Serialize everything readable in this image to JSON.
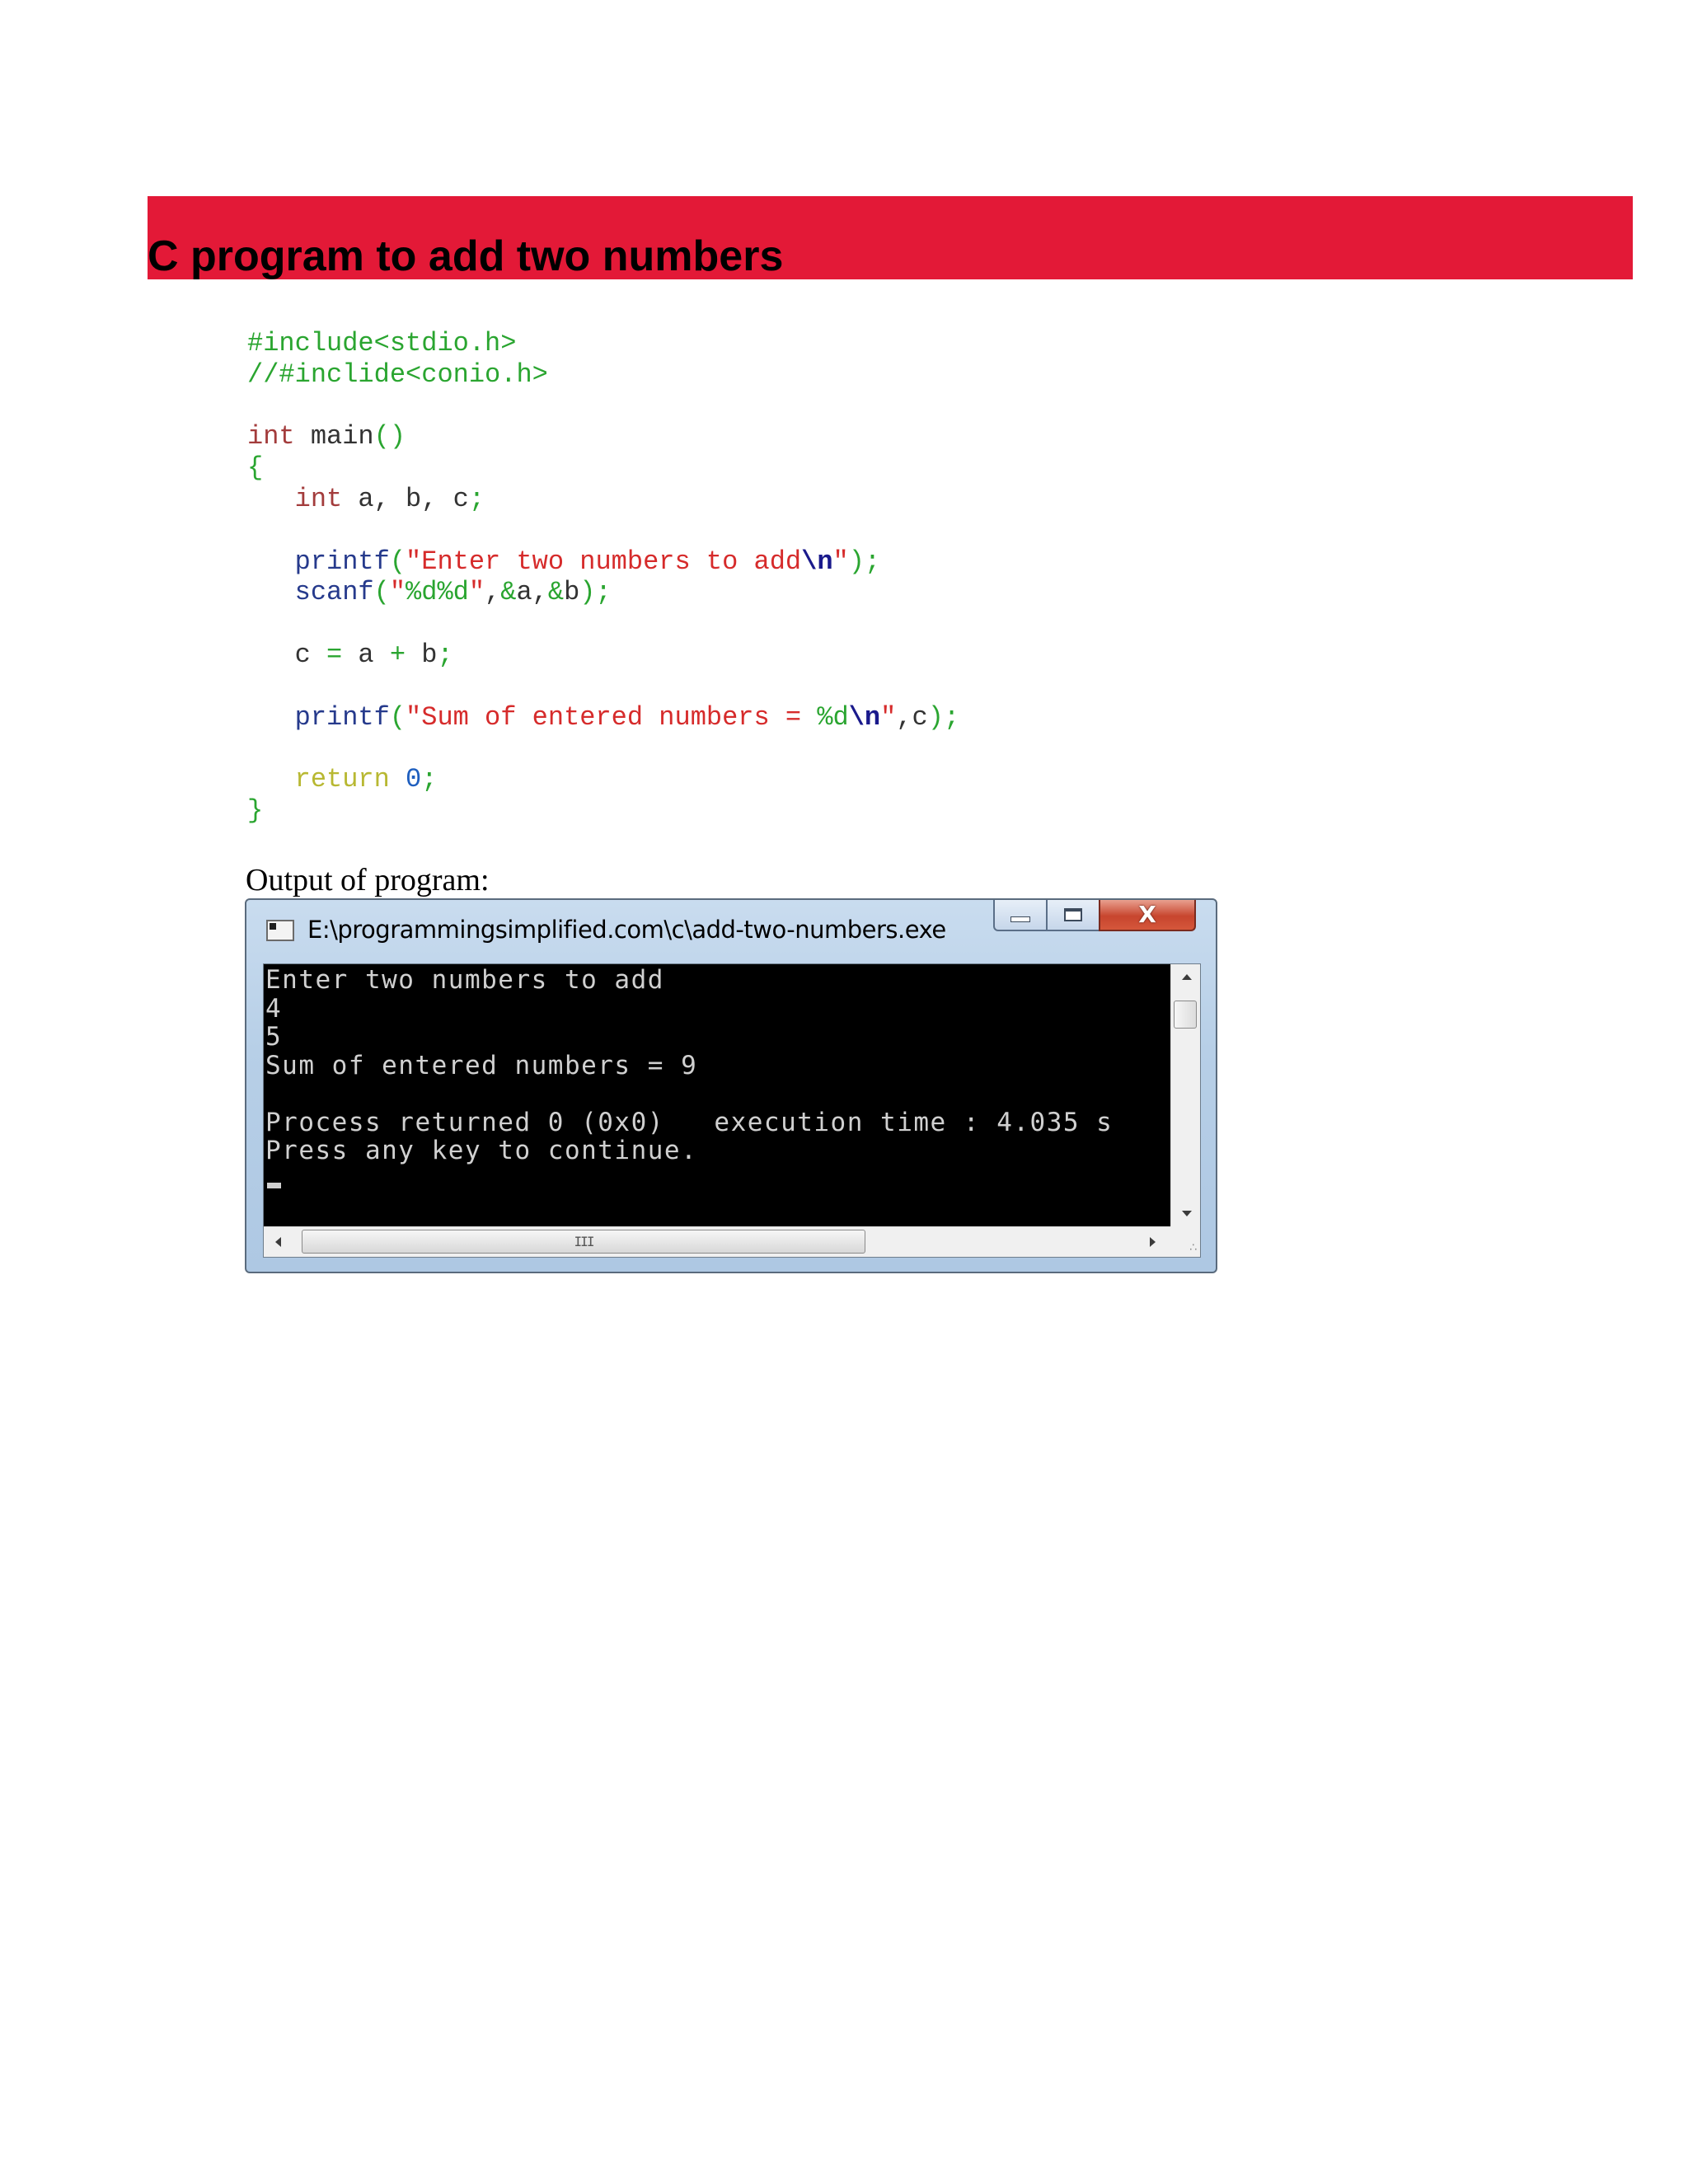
{
  "document": {
    "title": "C program to add two numbers",
    "output_heading": "Output of program:"
  },
  "code": {
    "l1_pre": "#include<stdio.h>",
    "l2_cmt": "//#inclide<conio.h>",
    "l4_type": "int",
    "l4_name": " main",
    "l4_parens": "()",
    "l5_open": "{",
    "l6_indent": "   ",
    "l6_type": "int",
    "l6_vars": " a, b, c",
    "l6_semi": ";",
    "l8_indent": "   ",
    "l8_fn": "printf",
    "l8_paren": "(",
    "l8_str": "\"Enter two numbers to add",
    "l8_esc": "\\n",
    "l8_strend": "\"",
    "l8_close": ");",
    "l9_indent": "   ",
    "l9_fn": "scanf",
    "l9_paren": "(",
    "l9_fmt_q": "\"",
    "l9_fmt": "%d%d",
    "l9_fmt_end": "\"",
    "l9_comma1": ",",
    "l9_amp1": "&",
    "l9_a": "a",
    "l9_comma2": ",",
    "l9_amp2": "&",
    "l9_b": "b",
    "l9_close": ");",
    "l11_indent": "   ",
    "l11_c": "c",
    "l11_eq": " = ",
    "l11_a": "a",
    "l11_plus": " + ",
    "l11_b": "b",
    "l11_semi": ";",
    "l13_indent": "   ",
    "l13_fn": "printf",
    "l13_paren": "(",
    "l13_str": "\"Sum of entered numbers = ",
    "l13_fmt": "%d",
    "l13_esc": "\\n",
    "l13_strend": "\"",
    "l13_comma": ",",
    "l13_c": "c",
    "l13_close": ");",
    "l15_indent": "   ",
    "l15_kw": "return",
    "l15_num": " 0",
    "l15_semi": ";",
    "l16_close": "}"
  },
  "console": {
    "window_title": "E:\\programmingsimplified.com\\c\\add-two-numbers.exe",
    "close_glyph": "X",
    "lines": [
      "Enter two numbers to add",
      "4",
      "5",
      "Sum of entered numbers = 9",
      "",
      "Process returned 0 (0x0)   execution time : 4.035 s",
      "Press any key to continue."
    ],
    "hscroll_grip": "III",
    "size_grip": "∴"
  },
  "colors": {
    "banner": "#e31937",
    "preprocessor": "#2aa530",
    "string": "#d62b2b",
    "function": "#263a8c",
    "return_keyword": "#b8b832",
    "console_background": "#000000",
    "console_text": "#d0d0d0"
  },
  "icons": {
    "console_app": "console-app-icon",
    "minimize": "minimize-icon",
    "maximize": "maximize-icon",
    "close": "close-icon",
    "scroll_up": "arrow-up-icon",
    "scroll_down": "arrow-down-icon",
    "scroll_left": "arrow-left-icon",
    "scroll_right": "arrow-right-icon",
    "size_grip": "resize-grip-icon"
  }
}
